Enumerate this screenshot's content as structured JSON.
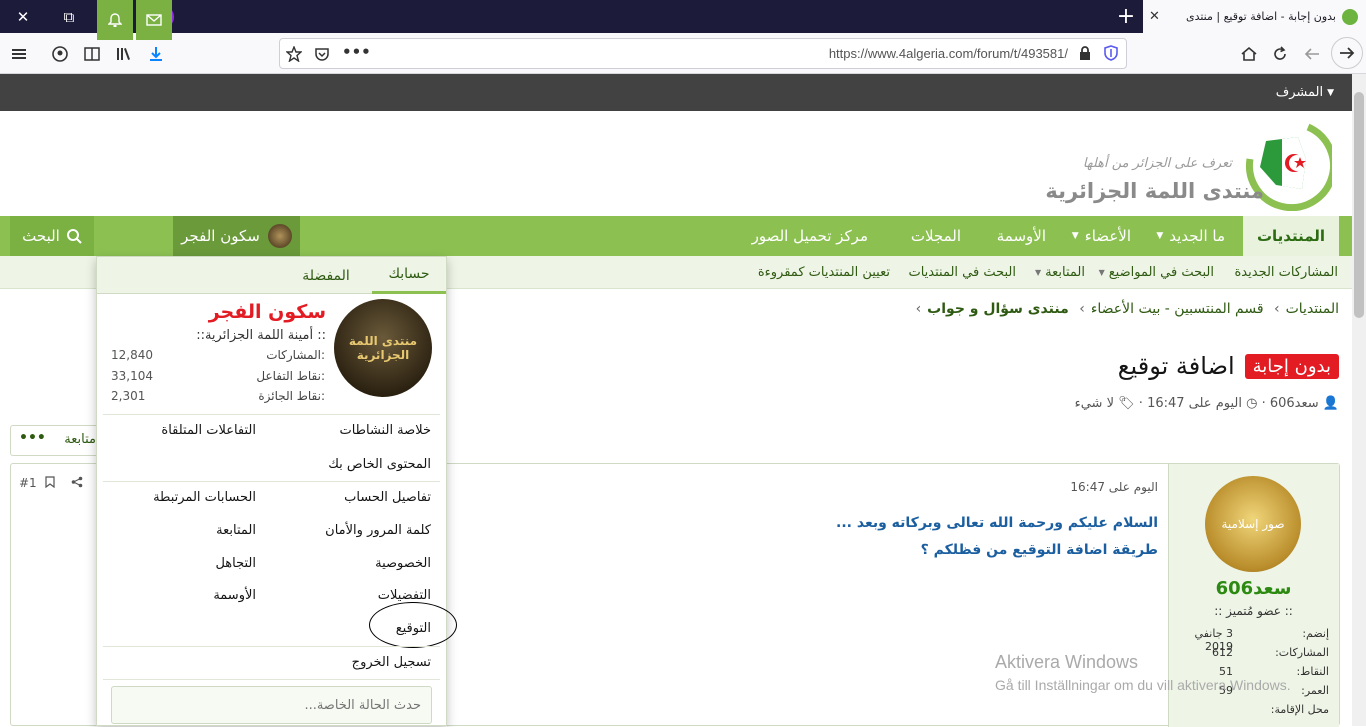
{
  "browser": {
    "window_controls": {
      "close": "✕",
      "restore": "⧉",
      "minimize": "—"
    },
    "tab": {
      "title": "بدون إجابة - اضافة توقيع | منتدى",
      "close": "✕"
    },
    "new_tab": "+",
    "url": "https://www.4algeria.com/forum/t/493581/"
  },
  "site": {
    "staff_menu": "المشرف",
    "logo_text": "منتدى اللمة الجزائرية",
    "logo_tagline": "تعرف على الجزائر من أهلها",
    "nav": {
      "forums": "المنتديات",
      "whats_new": "ما الجديد",
      "members": "الأعضاء",
      "medals": "الأوسمة",
      "magazines": "المجلات",
      "image_center": "مركز تحميل الصور",
      "username": "سكون الفجر",
      "search": "البحث"
    },
    "subnav": [
      "المشاركات الجديدة",
      "البحث في المواضيع",
      "المتابعة",
      "البحث في المنتديات",
      "تعيين المنتديات كمقروءة"
    ],
    "breadcrumb": [
      "المنتديات",
      "قسم المنتسبين - بيت الأعضاء",
      "منتدى سؤال و جواب"
    ],
    "thread": {
      "badge": "بدون إجابة",
      "title": "اضافة توقيع",
      "author": "سعد606",
      "date": "اليوم على 16:47",
      "tags": "لا شيء"
    },
    "follow_label": "متابعة",
    "post": {
      "date": "اليوم على 16:47",
      "number": "#1",
      "line1": "السلام عليكم ورحمة الله تعالى وبركاته وبعد ...",
      "line2": "طريقة اضافة التوقيع من فظلكم ؟",
      "avatar_text": "صور إسلامية",
      "username": "سعد606",
      "rank": ":: عضو مُتميز ::",
      "details": [
        {
          "k": "إنضم:",
          "v": "3 جانفي 2019"
        },
        {
          "k": "المشاركات:",
          "v": "612"
        },
        {
          "k": "النقاط:",
          "v": "51"
        },
        {
          "k": "العمر:",
          "v": "59"
        },
        {
          "k": "محل الإقامة:",
          "v": ""
        }
      ]
    },
    "watermark": {
      "line1": "Aktivera Windows",
      "line2": "Gå till Inställningar om du vill aktivera Windows."
    }
  },
  "account_menu": {
    "tabs": {
      "account": "حسابك",
      "bookmarks": "المفضلة"
    },
    "avatar_text": "منتدى اللمة الجزائرية",
    "name": "سكون الفجر",
    "title": ":: أمينة اللمة الجزائرية::",
    "stats": [
      {
        "k": "المشاركات:",
        "v": "12,840"
      },
      {
        "k": "نقاط التفاعل:",
        "v": "33,104"
      },
      {
        "k": "نقاط الجائزة:",
        "v": "2,301"
      }
    ],
    "items": {
      "activity_summary": "خلاصة النشاطات",
      "reactions_received": "التفاعلات المتلقاة",
      "your_content": "المحتوى الخاص بك",
      "account_details": "تفاصيل الحساب",
      "connected_accounts": "الحسابات المرتبطة",
      "password_security": "كلمة المرور والأمان",
      "following": "المتابعة",
      "privacy": "الخصوصية",
      "ignoring": "التجاهل",
      "preferences": "التفضيلات",
      "medals": "الأوسمة",
      "signature": "التوقيع",
      "logout": "تسجيل الخروج"
    },
    "status_placeholder": "حدث الحالة الخاصة..."
  }
}
